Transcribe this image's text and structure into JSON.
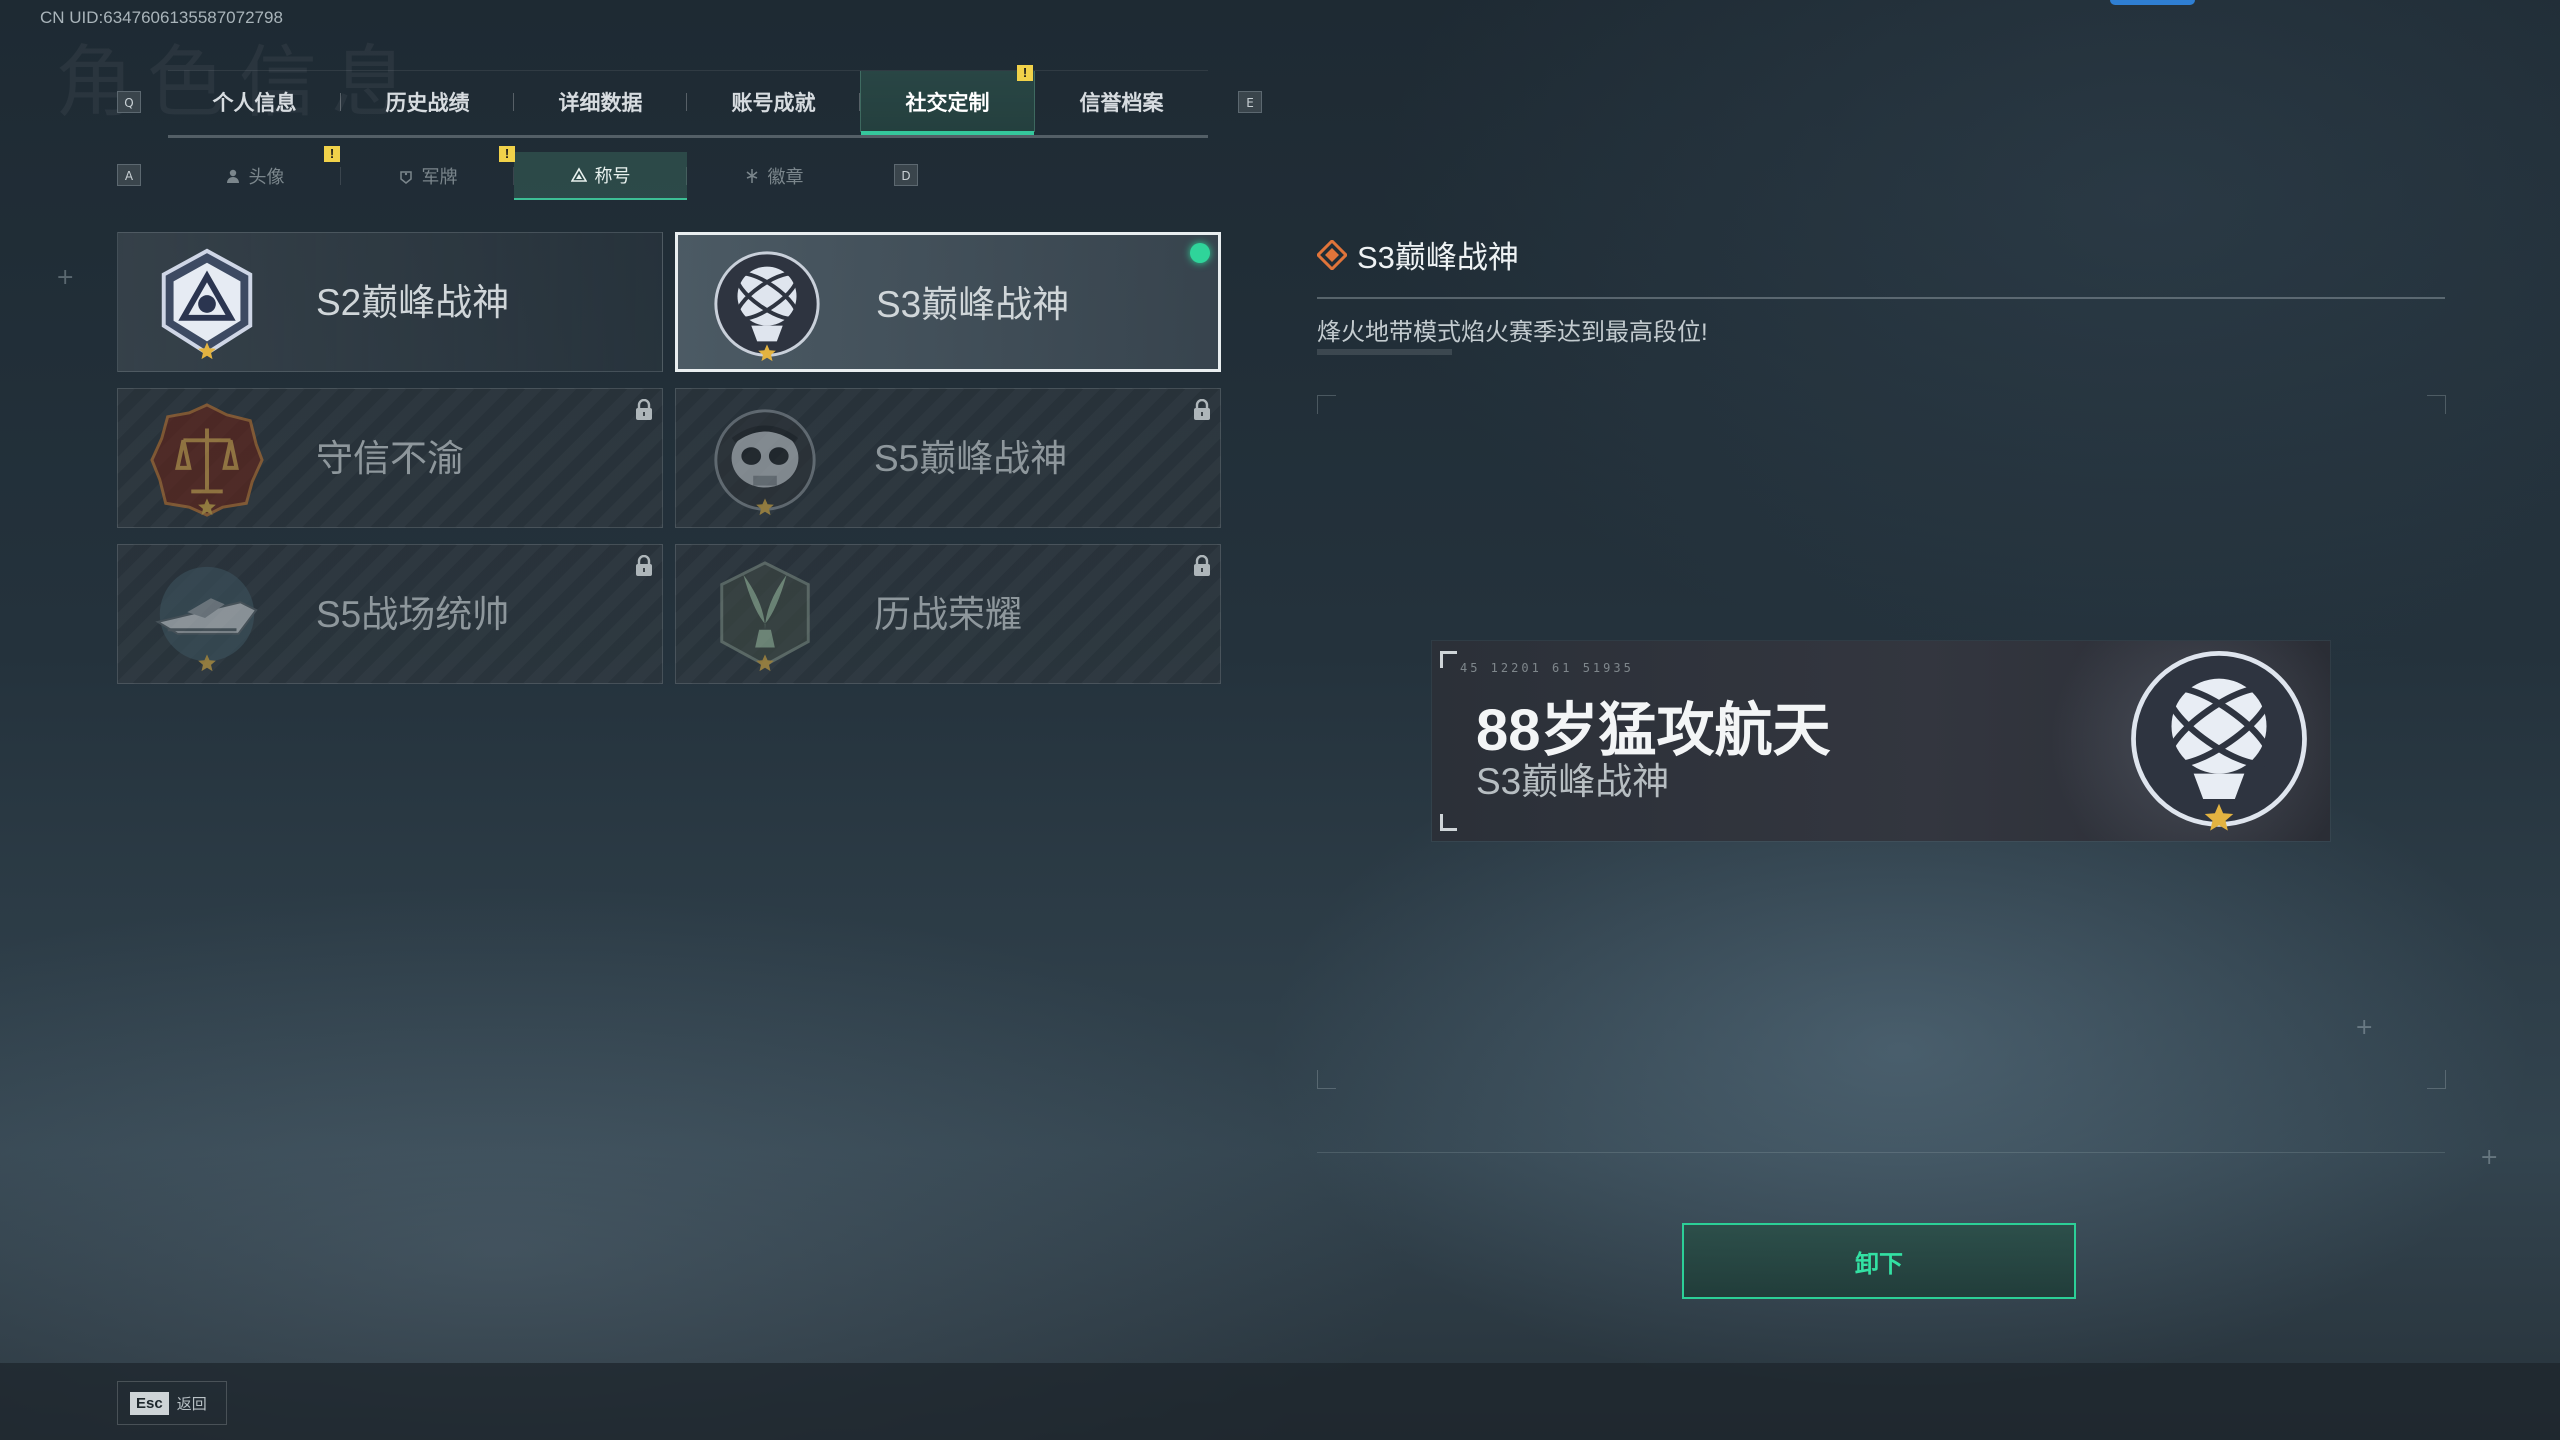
{
  "uid": "CN UID:634760613558707279​8",
  "ghost_title": "角色信息",
  "keys": {
    "prev_main": "Q",
    "next_main": "E",
    "prev_sub": "A",
    "next_sub": "D"
  },
  "main_tabs": [
    {
      "label": "个人信息"
    },
    {
      "label": "历史战绩"
    },
    {
      "label": "详细数据"
    },
    {
      "label": "账号成就"
    },
    {
      "label": "社交定制",
      "active": true,
      "badge": "!"
    },
    {
      "label": "信誉档案"
    }
  ],
  "sub_tabs": [
    {
      "label": "头像",
      "icon": "person-icon"
    },
    {
      "label": "军牌",
      "icon": "dogtag-icon",
      "badge": "!"
    },
    {
      "label": "称号",
      "icon": "title-icon",
      "active": true
    },
    {
      "label": "徽章",
      "icon": "badge-icon"
    }
  ],
  "sub_badge_avatar": "!",
  "titles": [
    {
      "name": "S2巅峰战神",
      "emblem": "s2-peak-emblem-icon",
      "locked": false,
      "selected": false
    },
    {
      "name": "S3巅峰战神",
      "emblem": "s3-peak-emblem-icon",
      "locked": false,
      "selected": true
    },
    {
      "name": "守信不渝",
      "emblem": "scales-emblem-icon",
      "locked": true
    },
    {
      "name": "S5巅峰战神",
      "emblem": "skull-emblem-icon",
      "locked": true
    },
    {
      "name": "S5战场统帅",
      "emblem": "boat-emblem-icon",
      "locked": true
    },
    {
      "name": "历战荣耀",
      "emblem": "trophy-emblem-icon",
      "locked": true
    }
  ],
  "detail": {
    "title": "S3巅峰战神",
    "description": "烽火地带模式焰火赛季达到最高段位!"
  },
  "nameplate": {
    "nickname": "88岁猛攻航天",
    "title": "S3巅峰战神",
    "code_text": "45 12201  61 51935"
  },
  "unequip_label": "卸下",
  "esc": {
    "key": "Esc",
    "label": "返回"
  },
  "colors": {
    "accent": "#35c79c",
    "badge": "#f1d24a",
    "equipped_dot": "#2fd49a"
  }
}
